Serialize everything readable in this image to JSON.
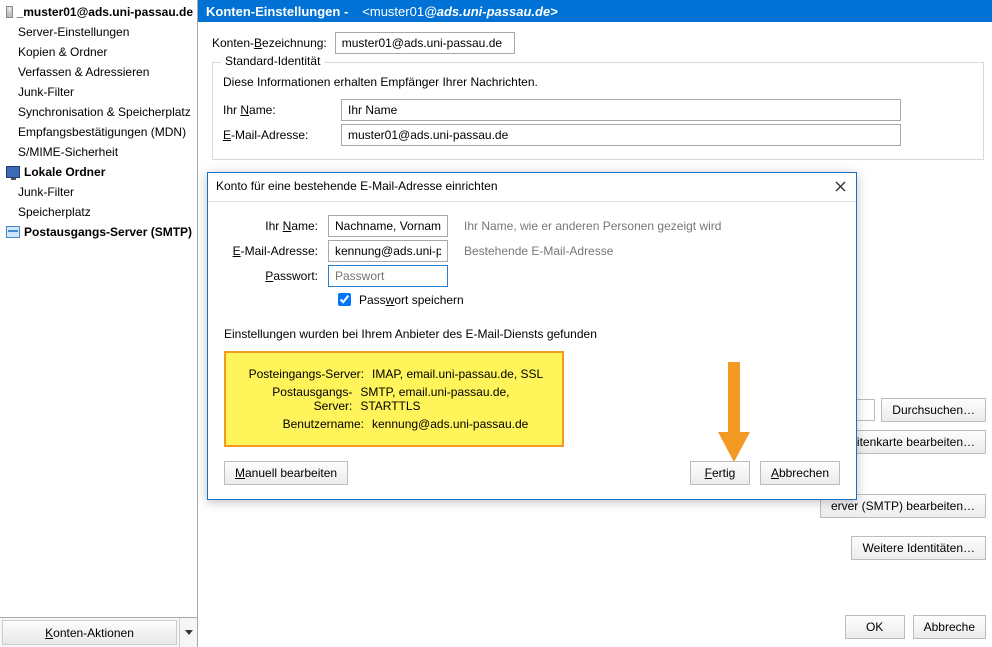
{
  "sidebar": {
    "items": [
      {
        "label": "_muster01@ads.uni-passau.de",
        "bold": true,
        "underline": true,
        "level": 0,
        "icon": "account"
      },
      {
        "label": "Server-Einstellungen",
        "level": 1
      },
      {
        "label": "Kopien & Ordner",
        "level": 1
      },
      {
        "label": "Verfassen & Adressieren",
        "level": 1
      },
      {
        "label": "Junk-Filter",
        "level": 1
      },
      {
        "label": "Synchronisation & Speicherplatz",
        "level": 1
      },
      {
        "label": "Empfangsbestätigungen (MDN)",
        "level": 1
      },
      {
        "label": "S/MIME-Sicherheit",
        "level": 1
      },
      {
        "label": "Lokale Ordner",
        "bold": true,
        "level": 0,
        "icon": "monitor"
      },
      {
        "label": "Junk-Filter",
        "level": 1
      },
      {
        "label": "Speicherplatz",
        "level": 1
      },
      {
        "label": "Postausgangs-Server (SMTP)",
        "bold": true,
        "level": 0,
        "icon": "smtp"
      }
    ],
    "footer_label": "Konten-Aktionen"
  },
  "header": {
    "title": "Konten-Einstellungen -",
    "email_user": "<muster01",
    "email_domain": "@ads.uni-passau.de>"
  },
  "account": {
    "label_field": "Konten-Bezeichnung:",
    "label_value": "muster01@ads.uni-passau.de"
  },
  "identity": {
    "legend": "Standard-Identität",
    "desc": "Diese Informationen erhalten Empfänger Ihrer Nachrichten.",
    "name_label": "Ihr Name:",
    "name_value": "Ihr Name",
    "email_label": "E-Mail-Adresse:",
    "email_value": "muster01@ads.uni-passau.de"
  },
  "right_buttons": {
    "browse": "Durchsuchen…",
    "vcard": "Visitenkarte bearbeiten…",
    "smtp": "erver (SMTP) bearbeiten…",
    "more_id": "Weitere Identitäten…"
  },
  "bottom": {
    "ok": "OK",
    "cancel": "Abbreche"
  },
  "wizard": {
    "title": "Konto für eine bestehende E-Mail-Adresse einrichten",
    "name_label": "Ihr Name:",
    "name_value": "Nachname, Vorname",
    "name_hint": "Ihr Name, wie er anderen Personen gezeigt wird",
    "email_label": "E-Mail-Adresse:",
    "email_value": "kennung@ads.uni-pas",
    "email_hint": "Bestehende E-Mail-Adresse",
    "pwd_label": "Passwort:",
    "pwd_placeholder": "Passwort",
    "remember": "Passwort speichern",
    "status": "Einstellungen wurden bei Ihrem Anbieter des E-Mail-Diensts gefunden",
    "server": {
      "in_label": "Posteingangs-Server:",
      "in_value": "IMAP, email.uni-passau.de, SSL",
      "out_label": "Postausgangs-Server:",
      "out_value": "SMTP, email.uni-passau.de, STARTTLS",
      "user_label": "Benutzername:",
      "user_value": "kennung@ads.uni-passau.de"
    },
    "manual": "Manuell bearbeiten",
    "done": "Fertig",
    "cancel": "Abbrechen"
  },
  "acc_underline": {
    "N": "N",
    "E": "E",
    "P": "P",
    "K": "K",
    "B": "B",
    "M": "M",
    "F": "F",
    "A": "A",
    "W": "W"
  }
}
